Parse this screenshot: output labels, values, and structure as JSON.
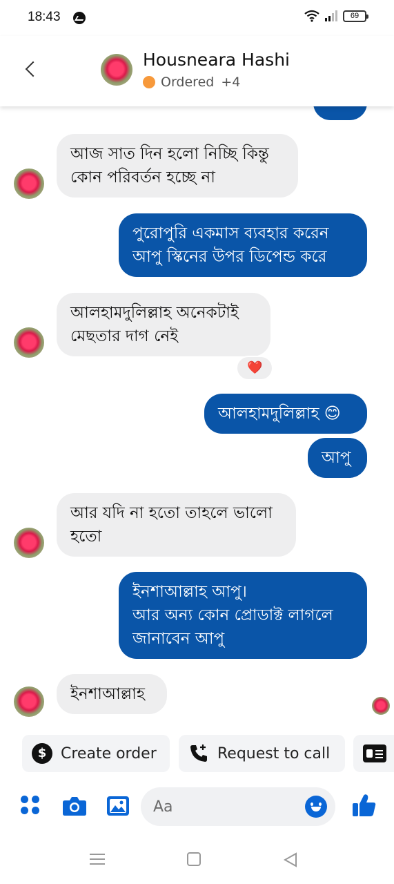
{
  "status_bar": {
    "time": "18:43",
    "battery": "69"
  },
  "header": {
    "name": "Housneara Hashi",
    "status": "Ordered",
    "extra": "+4"
  },
  "messages": [
    {
      "from": "contact",
      "text": "আজ সাত দিন হলো নিচ্ছি কিন্তু কোন পরিবর্তন হচ্ছে না"
    },
    {
      "from": "me",
      "text": "পুরোপুরি একমাস ব্যবহার করেন আপু স্কিনের উপর ডিপেন্ড করে"
    },
    {
      "from": "contact",
      "text": "আলহামদুলিল্লাহ অনেকটাই মেছতার দাগ নেই",
      "reaction": "❤️"
    },
    {
      "from": "me",
      "text": "আলহামদুলিল্লাহ 😊"
    },
    {
      "from": "me",
      "text": "আপু"
    },
    {
      "from": "contact",
      "text": "আর যদি না হতো তাহলে ভালো হতো"
    },
    {
      "from": "me",
      "text": "ইনশাআল্লাহ আপু।\nআর অন্য কোন প্রোডাক্ট লাগলে জানাবেন আপু"
    },
    {
      "from": "contact",
      "text": "ইনশাআল্লাহ"
    }
  ],
  "quick_actions": {
    "create_order": "Create order",
    "request_call": "Request to call"
  },
  "composer": {
    "placeholder": "Aa"
  },
  "icons": {
    "apps": "apps-grid-icon",
    "camera": "camera-icon",
    "gallery": "image-icon",
    "emoji": "emoji-icon",
    "like": "thumbs-up-icon"
  },
  "colors": {
    "outgoing_bubble": "#0a55a8",
    "incoming_bubble": "#eeeeef",
    "accent": "#0a66d6",
    "status_dot": "#f7993b"
  }
}
